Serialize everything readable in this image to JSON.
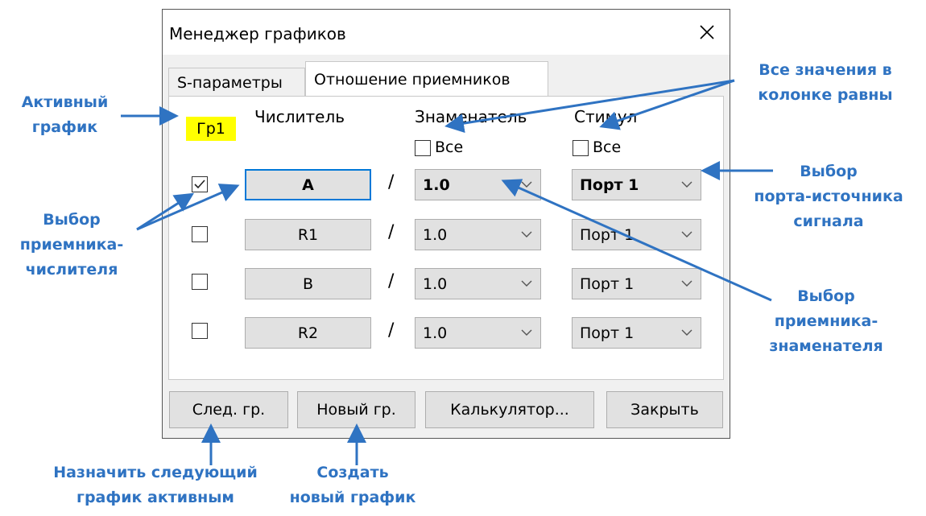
{
  "dialog": {
    "title": "Менеджер графиков",
    "close_icon": "close-icon"
  },
  "tabs": [
    {
      "label": "S-параметры",
      "active": false
    },
    {
      "label": "Отношение приемников",
      "active": true
    }
  ],
  "panel": {
    "active_trace_badge": "Гр1",
    "headers": {
      "numerator": "Числитель",
      "denominator": "Знаменатель",
      "stimulus": "Стимул"
    },
    "all_denominator_label": "Все",
    "all_stimulus_label": "Все",
    "rows": [
      {
        "checked": true,
        "numerator": "A",
        "slash": "/",
        "denominator": "1.0",
        "stimulus": "Порт 1"
      },
      {
        "checked": false,
        "numerator": "R1",
        "slash": "/",
        "denominator": "1.0",
        "stimulus": "Порт 1"
      },
      {
        "checked": false,
        "numerator": "B",
        "slash": "/",
        "denominator": "1.0",
        "stimulus": "Порт 1"
      },
      {
        "checked": false,
        "numerator": "R2",
        "slash": "/",
        "denominator": "1.0",
        "stimulus": "Порт 1"
      }
    ]
  },
  "footer": {
    "next_label": "След. гр.",
    "new_label": "Новый гр.",
    "calc_label": "Калькулятор...",
    "close_label": "Закрыть"
  },
  "annotations": {
    "active_trace": [
      "Активный",
      "график"
    ],
    "all_values": [
      "Все значения в",
      "колонке равны"
    ],
    "numerator_select": [
      "Выбор",
      "приемника-",
      "числителя"
    ],
    "source_port": [
      "Выбор",
      "порта-источника",
      "сигнала"
    ],
    "denominator_select": [
      "Выбор",
      "приемника-",
      "знаменателя"
    ],
    "next_active": [
      "Назначить следующий",
      "график активным"
    ],
    "create_new": [
      "Создать",
      "новый график"
    ]
  },
  "colors": {
    "annotation_blue": "#2f73c2",
    "badge_yellow": "#ffff00",
    "focus_blue": "#0078d7"
  }
}
